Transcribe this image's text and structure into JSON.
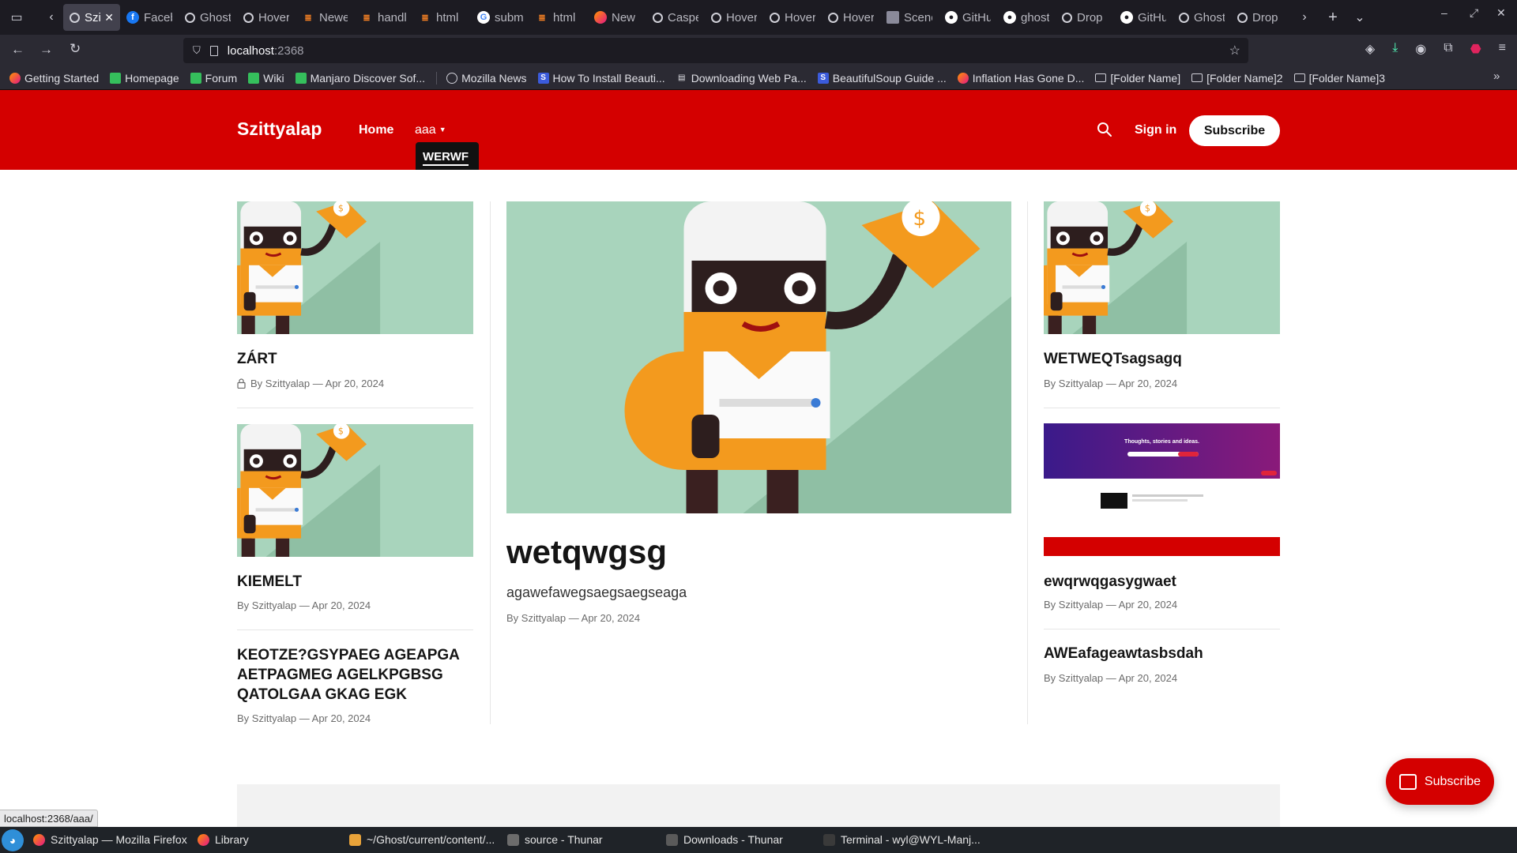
{
  "browser": {
    "tabs": [
      {
        "label": "Szittyalap",
        "icon": "ghost-icon",
        "active": true
      },
      {
        "label": "Facebook",
        "icon": "facebook-icon"
      },
      {
        "label": "Ghost",
        "icon": "ghost-icon"
      },
      {
        "label": "Hover",
        "icon": "ghost-icon"
      },
      {
        "label": "Newest",
        "icon": "stackoverflow-icon"
      },
      {
        "label": "handle",
        "icon": "stackoverflow-icon"
      },
      {
        "label": "html",
        "icon": "stackoverflow-icon"
      },
      {
        "label": "subm",
        "icon": "google-icon"
      },
      {
        "label": "html",
        "icon": "stackoverflow-icon"
      },
      {
        "label": "New",
        "icon": "firefox-icon"
      },
      {
        "label": "Casper",
        "icon": "ghost-icon"
      },
      {
        "label": "Hover",
        "icon": "ghost-icon"
      },
      {
        "label": "Hover",
        "icon": "ghost-icon"
      },
      {
        "label": "Hover",
        "icon": "ghost-icon"
      },
      {
        "label": "Scene",
        "icon": "image-icon"
      },
      {
        "label": "GitHub",
        "icon": "github-icon"
      },
      {
        "label": "ghost",
        "icon": "github-icon"
      },
      {
        "label": "Drop",
        "icon": "ghost-icon"
      },
      {
        "label": "GitHub",
        "icon": "github-icon"
      },
      {
        "label": "Ghost",
        "icon": "ghost-icon"
      },
      {
        "label": "Drop",
        "icon": "ghost-icon"
      }
    ],
    "url": {
      "host": "localhost",
      "port": ":2368"
    },
    "bookmarks": [
      {
        "label": "Getting Started",
        "icon": "firefox-icon"
      },
      {
        "label": "Homepage",
        "icon": "manjaro-icon"
      },
      {
        "label": "Forum",
        "icon": "manjaro-icon"
      },
      {
        "label": "Wiki",
        "icon": "manjaro-icon"
      },
      {
        "label": "Manjaro Discover Sof...",
        "icon": "manjaro-icon"
      },
      {
        "label": "Mozilla News",
        "icon": "globe-icon"
      },
      {
        "label": "How To Install Beauti...",
        "icon": "s-icon"
      },
      {
        "label": "Downloading Web Pa...",
        "icon": "page-icon"
      },
      {
        "label": "BeautifulSoup Guide ...",
        "icon": "s-icon"
      },
      {
        "label": "Inflation Has Gone D...",
        "icon": "bitcoin-icon"
      },
      {
        "label": "[Folder Name]",
        "icon": "folder-icon"
      },
      {
        "label": "[Folder Name]2",
        "icon": "folder-icon"
      },
      {
        "label": "[Folder Name]3",
        "icon": "folder-icon"
      }
    ],
    "status_url": "localhost:2368/aaa/"
  },
  "site": {
    "title": "Szittyalap",
    "nav_home": "Home",
    "nav_aaa": "aaa",
    "dropdown_item": "WERWF",
    "sign_in": "Sign in",
    "subscribe": "Subscribe",
    "float_subscribe": "Subscribe",
    "accent_color": "#d40000"
  },
  "posts": {
    "left": [
      {
        "title": "ZÁRT",
        "meta": "By Szittyalap — Apr 20, 2024",
        "locked": true
      },
      {
        "title": "KIEMELT",
        "meta": "By Szittyalap — Apr 20, 2024"
      },
      {
        "title": "KEOTZE?GSYPAEG AGEAPGA AETPAGMEG AGELKPGBSG QATOLGAA GKAG EGK",
        "meta": "By Szittyalap — Apr 20, 2024"
      }
    ],
    "featured": {
      "title": "wetqwgsg",
      "excerpt": "agawefawegsaegsaegseaga",
      "meta": "By Szittyalap — Apr 20, 2024"
    },
    "right": [
      {
        "title": "WETWEQTsagsagq",
        "meta": "By Szittyalap — Apr 20, 2024"
      },
      {
        "title": "ewqrwqgasygwaet",
        "meta": "By Szittyalap — Apr 20, 2024",
        "thumb_text": "Thoughts, stories and ideas."
      },
      {
        "title": "AWEafageawtasbsdah",
        "meta": "By Szittyalap — Apr 20, 2024"
      }
    ]
  },
  "taskbar": {
    "items": [
      {
        "label": "Szittyalap — Mozilla Firefox",
        "icon": "firefox-icon"
      },
      {
        "label": "Library",
        "icon": "firefox-icon"
      },
      {
        "label": "~/Ghost/current/content/...",
        "icon": "text-editor-icon"
      },
      {
        "label": "source - Thunar",
        "icon": "folder-icon"
      },
      {
        "label": "Downloads - Thunar",
        "icon": "download-icon"
      },
      {
        "label": "Terminal - wyl@WYL-Manj...",
        "icon": "terminal-icon"
      }
    ]
  }
}
